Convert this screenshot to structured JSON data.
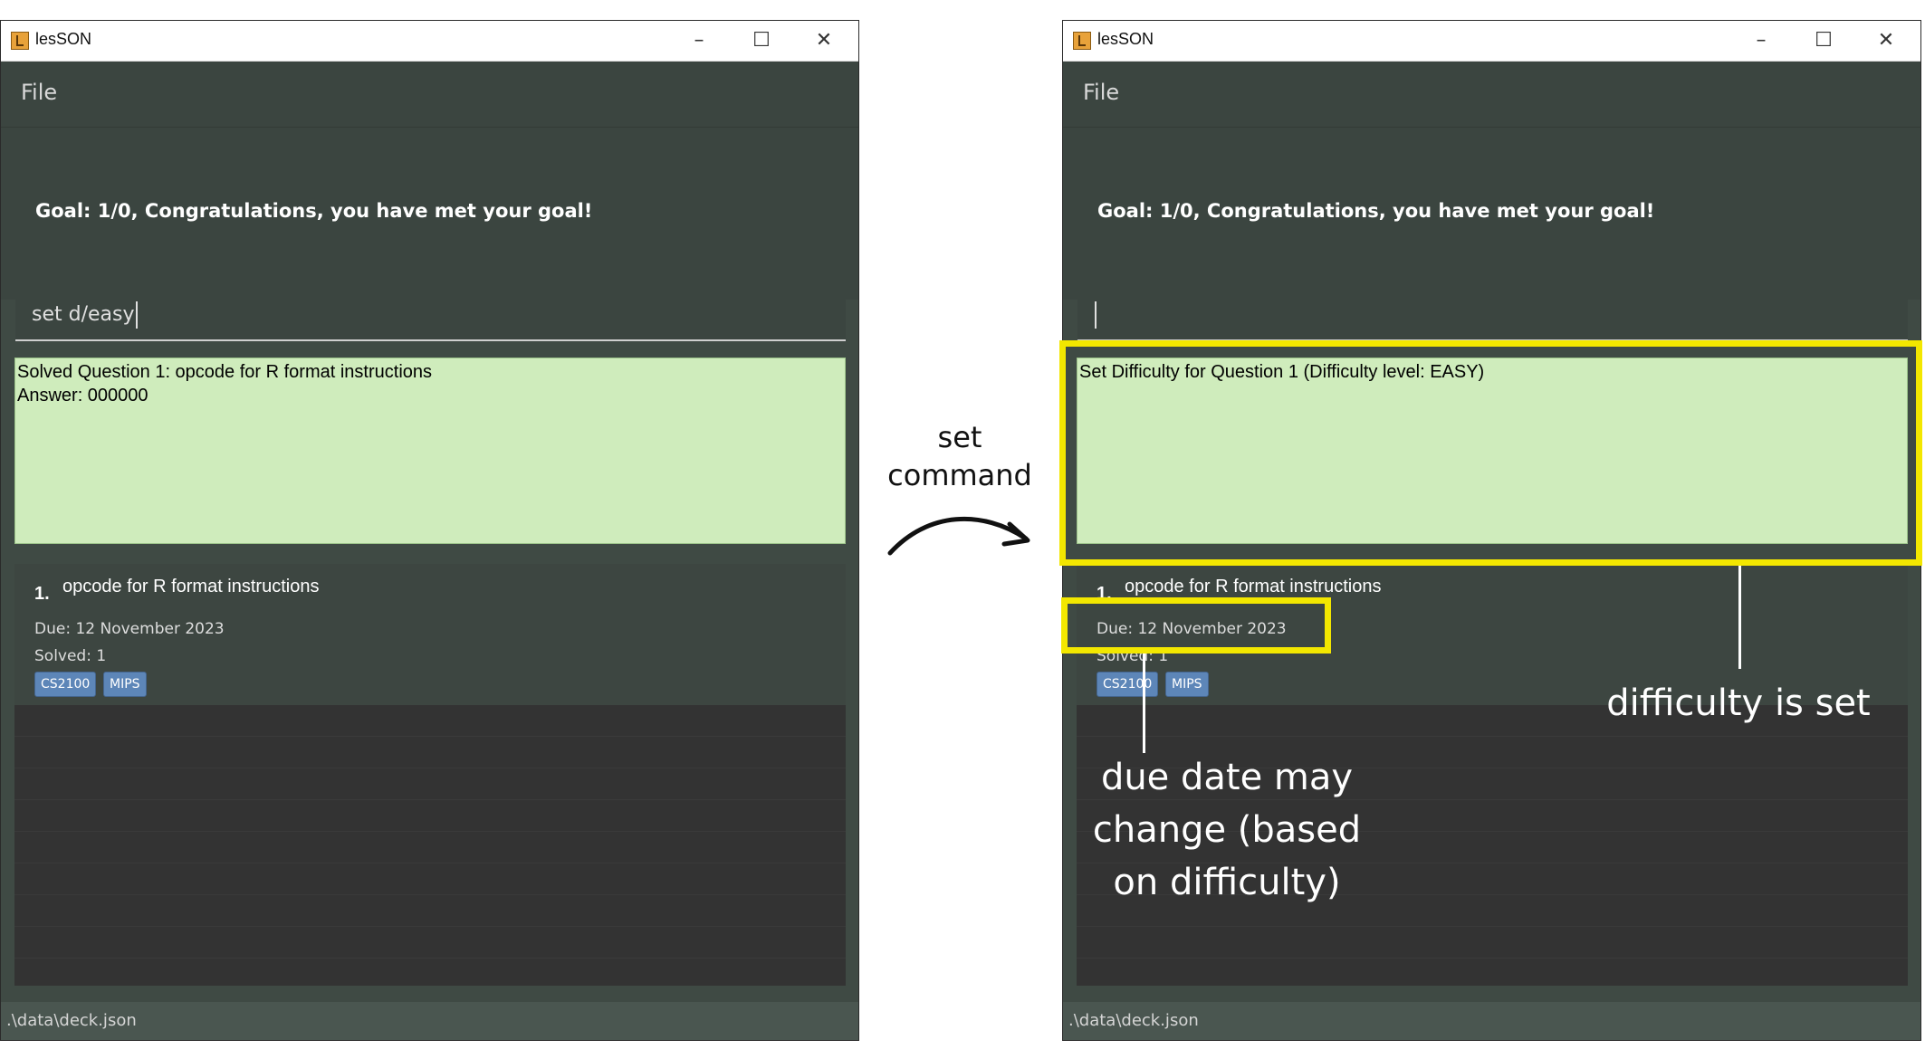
{
  "window": {
    "title": "lesSON",
    "minimize_glyph": "–",
    "maximize_glyph": "☐",
    "close_glyph": "✕"
  },
  "menu": {
    "file_label": "File"
  },
  "left": {
    "goal_text": "Goal: 1/0, Congratulations, you have met your goal!",
    "command_value": "set d/easy",
    "result_text": "Solved Question 1: opcode for R format instructions\nAnswer: 000000",
    "card": {
      "index": "1.",
      "question": "opcode for R format instructions",
      "due": "Due: 12 November 2023",
      "solved": "Solved: 1",
      "tags": [
        "CS2100",
        "MIPS"
      ]
    },
    "status_path": ".\\data\\deck.json"
  },
  "right": {
    "goal_text": "Goal: 1/0, Congratulations, you have met your goal!",
    "command_value": "",
    "result_text": "Set Difficulty for Question 1 (Difficulty level: EASY)",
    "card": {
      "index": "1.",
      "question": "opcode for R format instructions",
      "due": "Due: 12 November 2023",
      "solved": "Solved: 1",
      "tags": [
        "CS2100",
        "MIPS"
      ]
    },
    "status_path": ".\\data\\deck.json"
  },
  "annotations": {
    "arrow_label_line1": "set",
    "arrow_label_line2": "command",
    "difficulty_label": "difficulty is set",
    "due_label_line1": "due date may",
    "due_label_line2": "change (based",
    "due_label_line3": "on difficulty)"
  },
  "colors": {
    "highlight": "#f3e700",
    "window_bg": "#3f4a44",
    "result_bg": "#cfecbc",
    "tag_bg": "#5d86b8"
  }
}
